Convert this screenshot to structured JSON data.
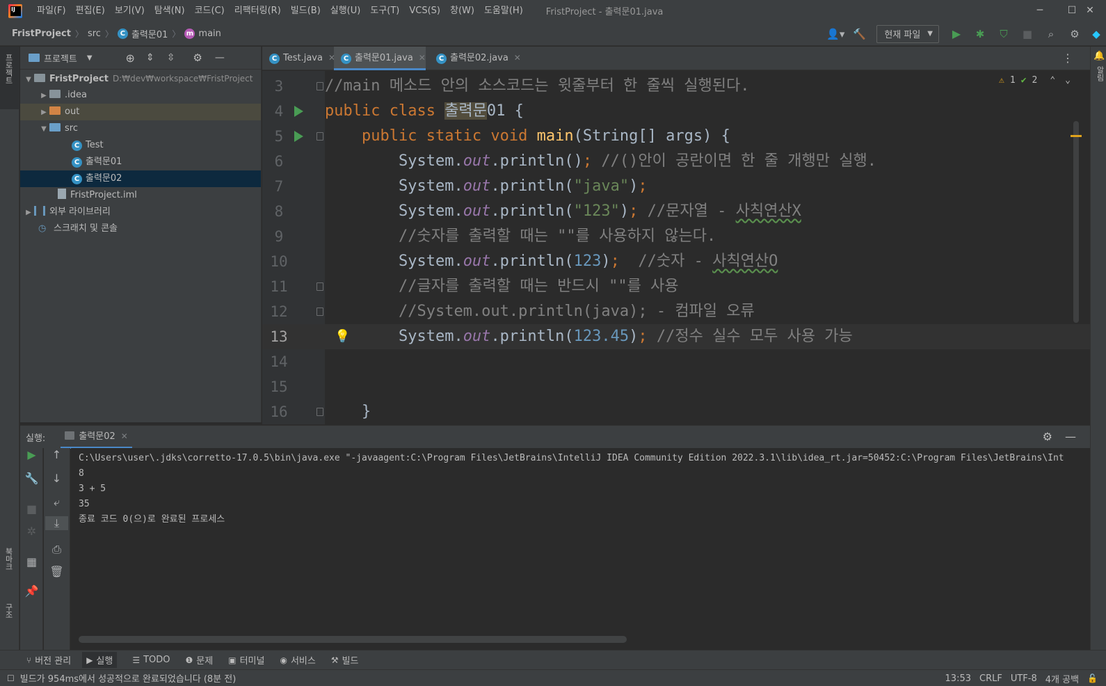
{
  "window": {
    "title": "FristProject - 출력문01.java",
    "menu": [
      "파일(F)",
      "편집(E)",
      "보기(V)",
      "탐색(N)",
      "코드(C)",
      "리팩터링(R)",
      "빌드(B)",
      "실행(U)",
      "도구(T)",
      "VCS(S)",
      "창(W)",
      "도움말(H)"
    ],
    "minimize": "─",
    "maximize": "☐",
    "close": "✕"
  },
  "navbar": {
    "project": "FristProject",
    "src": "src",
    "class": "출력문01",
    "method": "main",
    "run_config": "현재 파일"
  },
  "stripes": {
    "left_top": "프로젝트",
    "left_bookmarks": "북마크",
    "left_structure": "구조",
    "right_notifications": "알림"
  },
  "project_panel": {
    "title": "프로젝트",
    "root": {
      "name": "FristProject",
      "path": "D:₩dev₩workspace₩FristProject"
    },
    "items": [
      {
        "name": ".idea"
      },
      {
        "name": "out"
      },
      {
        "name": "src"
      },
      {
        "name": "Test"
      },
      {
        "name": "출력문01"
      },
      {
        "name": "출력문02"
      },
      {
        "name": "FristProject.iml"
      },
      {
        "name": "외부 라이브러리"
      },
      {
        "name": "스크래치 및 콘솔"
      }
    ]
  },
  "editor": {
    "tabs": [
      {
        "label": "Test.java"
      },
      {
        "label": "출력문01.java"
      },
      {
        "label": "출력문02.java"
      }
    ],
    "inspection": {
      "warnings": "1",
      "ok": "2"
    },
    "line_numbers": [
      "3",
      "4",
      "5",
      "6",
      "7",
      "8",
      "9",
      "10",
      "11",
      "12",
      "13",
      "14",
      "15",
      "16"
    ],
    "tokens": {
      "l3": "//main 메소드 안의 소스코드는 윗줄부터 한 줄씩 실행된다.",
      "l4_kw": "public class ",
      "l4_hl": "출력문",
      "l4_rest": "01 {",
      "l5_indent": "    ",
      "l5_kw": "public static void ",
      "l5_fn": "main",
      "l5_rest": "(String[] args) {",
      "indent": "        ",
      "sys": "System.",
      "out": "out",
      "println": ".println(",
      "semi": ";",
      "l6_close": ")",
      "l6_cm": " //()안이 공란이면 한 줄 개행만 실행.",
      "l7_str": "\"java\"",
      "close_paren": ")",
      "l8_str": "\"123\"",
      "l8_cm": " //문자열 - ",
      "l8_wavy": "사칙연산X",
      "l9_cm": "//숫자를 출력할 때는 \"\"를 사용하지 않는다.",
      "l10_num": "123",
      "l10_cm": "  //숫자 - ",
      "l10_wavy": "사칙연산O",
      "l11_cm": "//글자를 출력할 때는 반드시 \"\"를 사용",
      "l12_cm": "//System.out.println(java); - 컴파일 오류",
      "l13_num": "123.45",
      "l13_cm": " //정수 실수 모두 사용 가능",
      "l16_brace": "    }"
    }
  },
  "run_panel": {
    "label": "실행:",
    "tab": "출력문02",
    "console": [
      "C:\\Users\\user\\.jdks\\corretto-17.0.5\\bin\\java.exe \"-javaagent:C:\\Program Files\\JetBrains\\IntelliJ IDEA Community Edition 2022.3.1\\lib\\idea_rt.jar=50452:C:\\Program Files\\JetBrains\\Int",
      "8",
      "3 + 5",
      "35",
      "",
      "종료 코드 0(으)로 완료된 프로세스"
    ]
  },
  "tool_windows": [
    "버전 관리",
    "실행",
    "TODO",
    "문제",
    "터미널",
    "서비스",
    "빌드"
  ],
  "status": {
    "message": "빌드가 954ms에서 성공적으로 완료되었습니다 (8분 전)",
    "position": "13:53",
    "line_sep": "CRLF",
    "encoding": "UTF-8",
    "indent": "4개 공백"
  },
  "colors": {
    "accent": "#4a88c7",
    "run_green": "#499c54",
    "keyword": "#cc7832",
    "string": "#6a8759",
    "number": "#6897bb",
    "comment": "#808080"
  }
}
